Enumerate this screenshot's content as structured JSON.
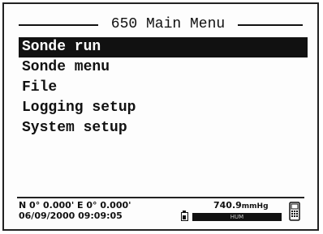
{
  "title": "650 Main Menu",
  "menu": {
    "items": [
      {
        "label": "Sonde run",
        "selected": true
      },
      {
        "label": "Sonde menu",
        "selected": false
      },
      {
        "label": "File",
        "selected": false
      },
      {
        "label": "Logging setup",
        "selected": false
      },
      {
        "label": "System setup",
        "selected": false
      }
    ]
  },
  "status": {
    "gps": "N 0° 0.000' E  0° 0.000'",
    "datetime": "06/09/2000 09:09:05",
    "pressure_value": "740.9",
    "pressure_unit": "mmHg",
    "level_text": "HUM",
    "icons": {
      "battery": "battery-icon",
      "handheld": "handheld-device-icon"
    }
  },
  "colors": {
    "foreground": "#111111",
    "background": "#fdfdfd",
    "selection": "#111111"
  }
}
